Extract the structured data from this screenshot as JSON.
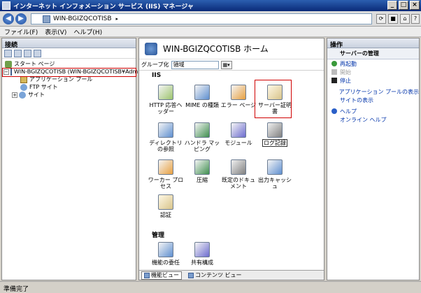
{
  "window": {
    "title": "インターネット インフォメーション サービス (IIS) マネージャ"
  },
  "address": {
    "server": "WIN-BGIZQCOTISB",
    "separator": "▸"
  },
  "menu": [
    "ファイル(F)",
    "表示(V)",
    "ヘルプ(H)"
  ],
  "left": {
    "header": "接続",
    "tree": {
      "start_page": "スタート ページ",
      "server": "WIN-BGIZQCOTISB (WIN-BGIZQCOTISB¥Admir",
      "app_pool": "アプリケーション プール",
      "ftp": "FTP サイト",
      "sites": "サイト"
    }
  },
  "center": {
    "title": "WIN-BGIZQCOTISB ホーム",
    "group_label": "グループ化",
    "group_value": "領域",
    "sections": {
      "iis": "IIS",
      "management": "管理"
    },
    "features": {
      "http_headers": "HTTP 応答ヘッダー",
      "mime": "MIME の種類",
      "error_pages": "エラー ページ",
      "server_cert": "サーバー証明書",
      "dir_browse": "ディレクトリの参照",
      "handler": "ハンドラ マッピング",
      "modules": "モジュール",
      "logging": "ログ記録",
      "worker": "ワーカー プロセス",
      "compression": "圧縮",
      "default_doc": "既定のドキュメント",
      "output_cache": "出力キャッシュ",
      "auth": "認証",
      "delegation": "機能の委任",
      "shared_config": "共有構成"
    },
    "tabs": {
      "features_view": "機能ビュー",
      "content_view": "コンテンツ ビュー"
    }
  },
  "right": {
    "header": "操作",
    "group": "サーバーの管理",
    "actions": {
      "restart": "再起動",
      "start": "開始",
      "stop": "停止",
      "view_app_pools": "アプリケーション プールの表示",
      "view_sites": "サイトの表示",
      "help": "ヘルプ",
      "online_help": "オンライン ヘルプ"
    }
  },
  "status": "準備完了",
  "colors": {
    "highlight_box": "#d00000",
    "link": "#0033aa"
  }
}
